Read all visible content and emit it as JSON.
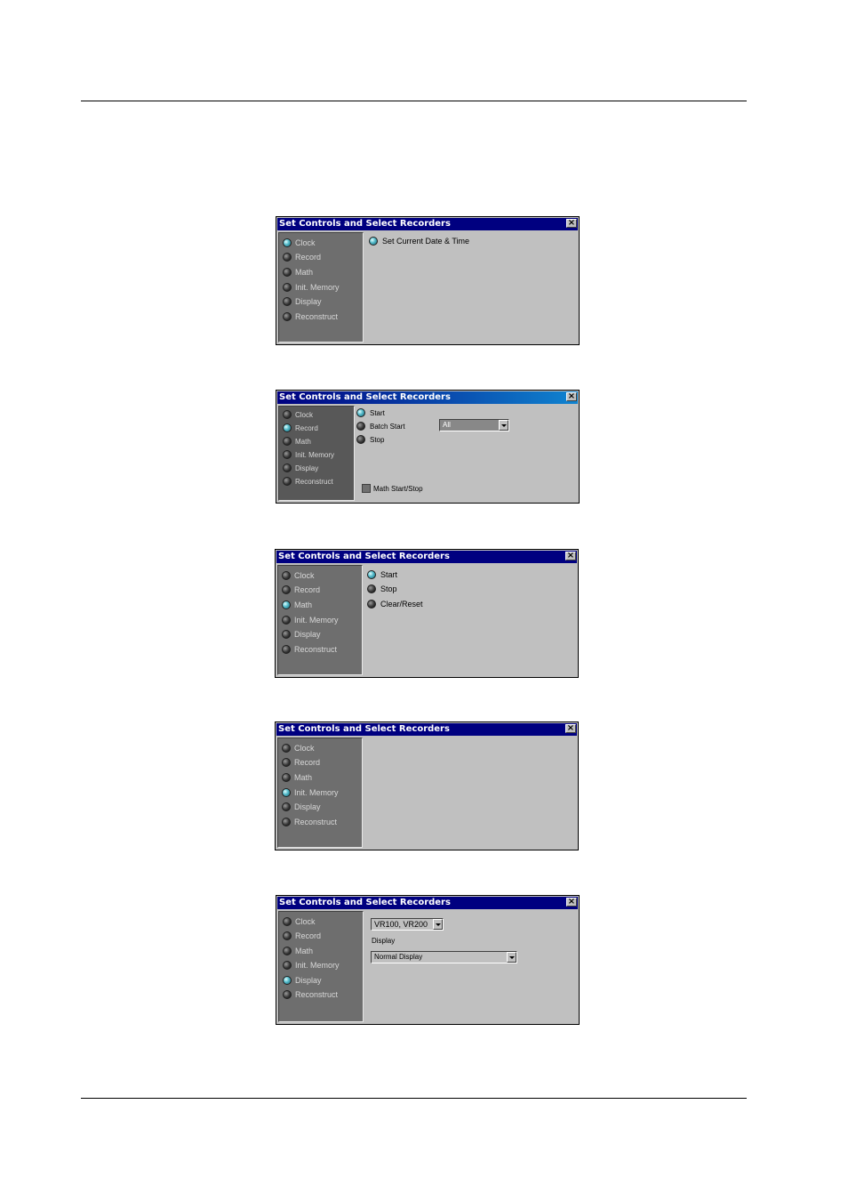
{
  "dialog_title": "Set Controls and Select Recorders",
  "sidebar_items": [
    "Clock",
    "Record",
    "Math",
    "Init. Memory",
    "Display",
    "Reconstruct"
  ],
  "dialogs": {
    "clock": {
      "selected": "Clock",
      "actions": [
        "Set Current Date & Time"
      ]
    },
    "record": {
      "selected": "Record",
      "actions": [
        "Start",
        "Batch Start",
        "Stop"
      ],
      "batch_select_value": "All",
      "math_checkbox_label": "Math Start/Stop"
    },
    "math": {
      "selected": "Math",
      "actions": [
        "Start",
        "Stop",
        "Clear/Reset"
      ]
    },
    "init_memory": {
      "selected": "Init. Memory"
    },
    "display": {
      "selected": "Display",
      "recorder_select_value": "VR100, VR200",
      "display_label": "Display",
      "display_select_value": "Normal Display"
    }
  }
}
